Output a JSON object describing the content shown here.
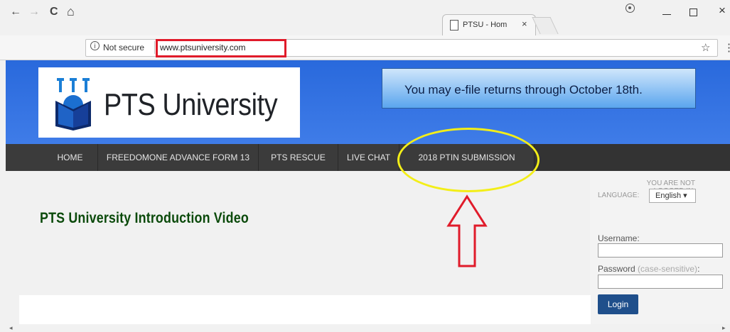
{
  "browser": {
    "tab_title": "PTSU - Hom",
    "tab_close": "×",
    "not_secure": "Not secure",
    "url": "www.ptsuniversity.com",
    "info_glyph": "i",
    "back_glyph": "←",
    "forward_glyph": "→",
    "reload_glyph": "C",
    "home_glyph": "⌂",
    "star_glyph": "☆",
    "menu_glyph": "⋮",
    "close_glyph": "×"
  },
  "header": {
    "logo_text": "PTS University",
    "notice": "You may e-file returns through October 18th."
  },
  "nav": {
    "items": [
      {
        "label": "HOME"
      },
      {
        "label": "FREEDOMONE ADVANCE FORM 13"
      },
      {
        "label": "PTS RESCUE"
      },
      {
        "label": "LIVE CHAT"
      },
      {
        "label": "2018 PTIN SUBMISSION"
      }
    ]
  },
  "content": {
    "title": "PTS University Introduction Video"
  },
  "sidebar": {
    "login_status": "YOU ARE NOT LOGGED IN.",
    "language_label": "LANGUAGE:",
    "language_value": "English ▾",
    "username_label": "Username:",
    "password_label": "Password",
    "password_hint": "(case-sensitive)",
    "password_colon": ":",
    "login_button": "Login"
  },
  "scroll": {
    "left_glyph": "◂",
    "right_glyph": "▸"
  },
  "colors": {
    "header_blue": "#2b6de0",
    "annotation_red": "#e01b2a",
    "annotation_yellow": "#f3ee18",
    "nav_dark": "#3b3b3b",
    "title_green": "#0b4a0b"
  }
}
